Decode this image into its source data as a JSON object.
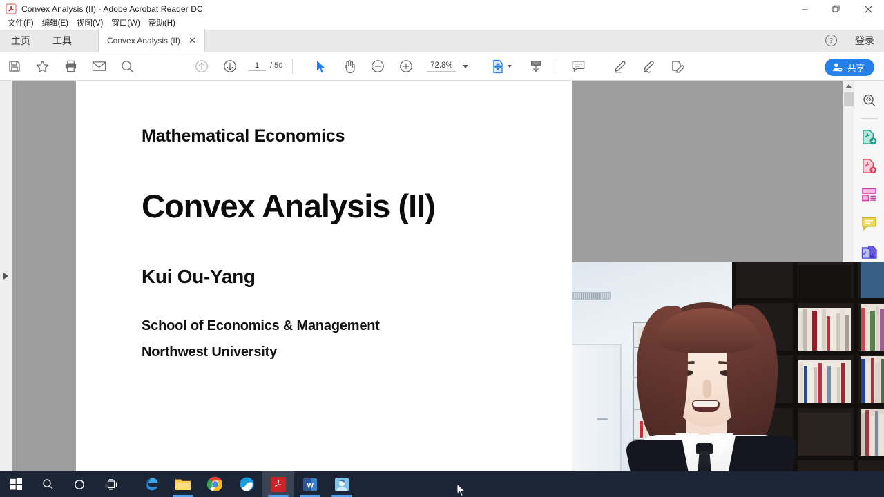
{
  "window": {
    "title": "Convex Analysis (II) - Adobe Acrobat Reader DC",
    "app_icon": "adobe-acrobat-icon",
    "controls": {
      "minimize": "—",
      "maximize": "❐",
      "close": "✕"
    }
  },
  "menubar": {
    "items": [
      {
        "label": "文件(F)",
        "name": "menu-file"
      },
      {
        "label": "编辑(E)",
        "name": "menu-edit"
      },
      {
        "label": "视图(V)",
        "name": "menu-view"
      },
      {
        "label": "窗口(W)",
        "name": "menu-window"
      },
      {
        "label": "帮助(H)",
        "name": "menu-help"
      }
    ]
  },
  "tabstrip": {
    "home_label": "主页",
    "tools_label": "工具",
    "document_tab": {
      "label": "Convex Analysis (II)",
      "close": "✕"
    },
    "help_glyph": "?",
    "signin_label": "登录"
  },
  "toolbar": {
    "icons": [
      {
        "name": "save-icon",
        "title": "save"
      },
      {
        "name": "star-icon",
        "title": "add-to-favorites"
      },
      {
        "name": "print-icon",
        "title": "print"
      },
      {
        "name": "email-icon",
        "title": "email"
      },
      {
        "name": "search-icon",
        "title": "find"
      }
    ],
    "page_up_icon": "page-up-icon",
    "page_down_icon": "page-down-icon",
    "page_number": "1",
    "page_total": "/ 50",
    "select_tool_icon": "select-cursor-icon",
    "hand_tool_icon": "hand-icon",
    "zoom_out_icon": "zoom-out-icon",
    "zoom_in_icon": "zoom-in-icon",
    "zoom_value": "72.8%",
    "fit_page_icon": "fit-page-icon",
    "scroll_mode_icon": "scroll-mode-icon",
    "comment_icon": "comment-icon",
    "highlight_icon": "highlight-icon",
    "sign_icon": "sign-icon",
    "fillsign_icon": "fill-and-sign-icon",
    "share_label": "共享",
    "share_icon": "share-person-icon",
    "accent_color": "#2680eb"
  },
  "right_rail": {
    "items": [
      {
        "name": "search-document-icon",
        "title": "search-document"
      },
      {
        "name": "export-pdf-icon",
        "title": "export-pdf"
      },
      {
        "name": "create-pdf-icon",
        "title": "create-pdf"
      },
      {
        "name": "organize-pages-icon",
        "title": "organize-pages"
      },
      {
        "name": "comment-rail-icon",
        "title": "comment"
      },
      {
        "name": "combine-files-icon",
        "title": "combine-files"
      }
    ]
  },
  "document": {
    "subtitle": "Mathematical Economics",
    "title": "Convex Analysis (II)",
    "author": "Kui Ou-Yang",
    "affiliation_line1": "School of Economics & Management",
    "affiliation_line2": "Northwest University"
  },
  "webcam": {
    "name": "webcam-overlay",
    "description": "presenter speaking in front of bookshelves"
  },
  "taskbar": {
    "items": [
      {
        "name": "start-button",
        "title": "Start"
      },
      {
        "name": "search-taskbar-icon",
        "title": "Search"
      },
      {
        "name": "cortana-icon",
        "title": "Cortana"
      },
      {
        "name": "task-view-icon",
        "title": "Task View"
      },
      {
        "name": "edge-icon",
        "title": "Microsoft Edge"
      },
      {
        "name": "file-explorer-icon",
        "title": "File Explorer"
      },
      {
        "name": "chrome-icon",
        "title": "Google Chrome"
      },
      {
        "name": "qq-browser-icon",
        "title": "QQ Browser"
      },
      {
        "name": "acrobat-reader-icon",
        "title": "Adobe Acrobat Reader DC"
      },
      {
        "name": "word-icon",
        "title": "Microsoft Word"
      },
      {
        "name": "meeting-app-icon",
        "title": "Meeting App"
      }
    ]
  }
}
